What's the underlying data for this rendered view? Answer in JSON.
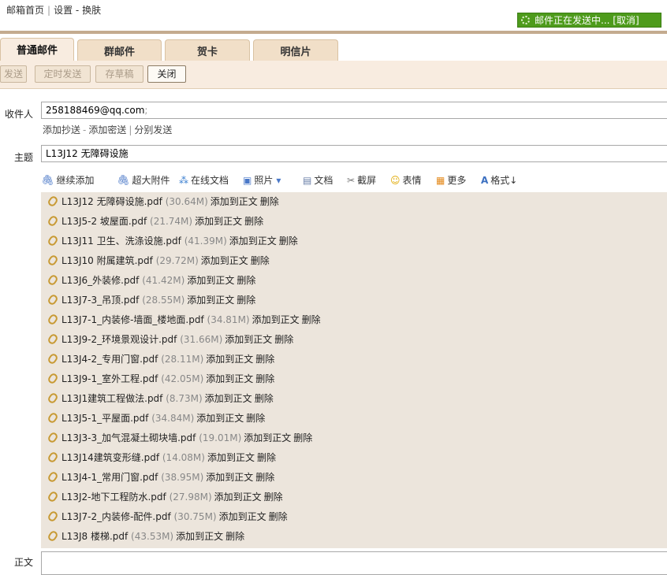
{
  "topnav": {
    "home": "邮箱首页",
    "sep": "|",
    "settings": "设置",
    "dash": "-",
    "skin": "换肤"
  },
  "sending": {
    "text": "邮件正在发送中... ",
    "cancel": "[取消]"
  },
  "tabs": [
    "普通邮件",
    "群邮件",
    "贺卡",
    "明信片"
  ],
  "toolbar": {
    "send": "发送",
    "scheduled": "定时发送",
    "draft": "存草稿",
    "close": "关闭"
  },
  "recipient": {
    "label": "收件人",
    "value": "258188469@qq.com",
    "semicolon": ";"
  },
  "cc": {
    "add_cc": "添加抄送",
    "dash": "-",
    "add_bcc": "添加密送",
    "sep": "|",
    "separate": "分别发送"
  },
  "subject": {
    "label": "主题",
    "value": "L13J12 无障碍设施"
  },
  "attach_toolbar": {
    "continue_add": "继续添加",
    "large": "超大附件",
    "online_doc": "在线文档",
    "photo": "照片",
    "doc": "文档",
    "screenshot": "截屏",
    "emoji": "表情",
    "more": "更多",
    "format": "格式↓"
  },
  "attachments": [
    {
      "name": "L13J12 无障碍设施.pdf",
      "size": "(30.64M)"
    },
    {
      "name": "L13J5-2 坡屋面.pdf",
      "size": "(21.74M)"
    },
    {
      "name": "L13J11 卫生、洗涤设施.pdf",
      "size": "(41.39M)"
    },
    {
      "name": "L13J10 附属建筑.pdf",
      "size": "(29.72M)"
    },
    {
      "name": "L13J6_外装修.pdf",
      "size": "(41.42M)"
    },
    {
      "name": "L13J7-3_吊顶.pdf",
      "size": "(28.55M)"
    },
    {
      "name": "L13J7-1_内装修-墙面_楼地面.pdf",
      "size": "(34.81M)"
    },
    {
      "name": "L13J9-2_环境景观设计.pdf",
      "size": "(31.66M)"
    },
    {
      "name": "L13J4-2_专用门窗.pdf",
      "size": "(28.11M)"
    },
    {
      "name": "L13J9-1_室外工程.pdf",
      "size": "(42.05M)"
    },
    {
      "name": "L13J1建筑工程做法.pdf",
      "size": "(8.73M)"
    },
    {
      "name": "L13J5-1_平屋面.pdf",
      "size": "(34.84M)"
    },
    {
      "name": "L13J3-3_加气混凝土砌块墙.pdf",
      "size": "(19.01M)"
    },
    {
      "name": "L13J14建筑变形缝.pdf",
      "size": "(14.08M)"
    },
    {
      "name": "L13J4-1_常用门窗.pdf",
      "size": "(38.95M)"
    },
    {
      "name": "L13J2-地下工程防水.pdf",
      "size": "(27.98M)"
    },
    {
      "name": "L13J7-2_内装修-配件.pdf",
      "size": "(30.75M)"
    },
    {
      "name": "L13J8 楼梯.pdf",
      "size": "(43.53M)"
    }
  ],
  "attachment_actions": {
    "insert": "添加到正文",
    "delete": "删除"
  },
  "body": {
    "label": "正文"
  },
  "colors": {
    "sending_bg": "#4e9b1c",
    "tab_bg": "#f1dfc8",
    "toolbar_bg": "#f8ece0",
    "attach_bg": "#ece5dc",
    "clip": "#c89a34"
  }
}
